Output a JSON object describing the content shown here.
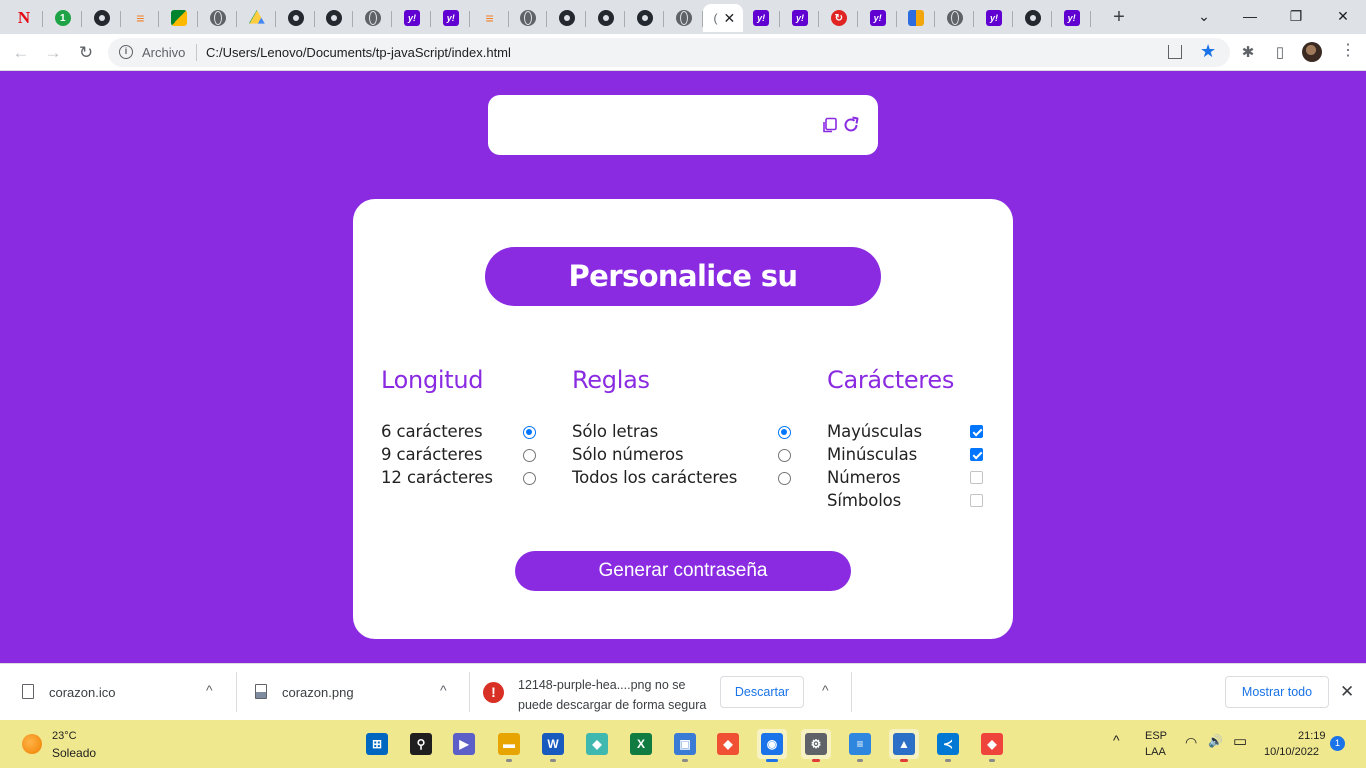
{
  "browser": {
    "tabs": [
      {
        "icon": "netflix-icon",
        "glyph": "N"
      },
      {
        "icon": "green-counter-icon",
        "glyph": "1"
      },
      {
        "icon": "github-icon",
        "glyph": ""
      },
      {
        "icon": "stackoverflow-icon",
        "glyph": "≡"
      },
      {
        "icon": "google-meet-icon",
        "glyph": ""
      },
      {
        "icon": "globe-icon",
        "glyph": ""
      },
      {
        "icon": "google-drive-icon",
        "glyph": ""
      },
      {
        "icon": "github-icon",
        "glyph": ""
      },
      {
        "icon": "github-icon",
        "glyph": ""
      },
      {
        "icon": "globe-icon",
        "glyph": ""
      },
      {
        "icon": "yahoo-icon",
        "glyph": "y!"
      },
      {
        "icon": "yahoo-icon",
        "glyph": "y!"
      },
      {
        "icon": "stackoverflow-icon",
        "glyph": "≡"
      },
      {
        "icon": "globe-icon",
        "glyph": ""
      },
      {
        "icon": "github-icon",
        "glyph": ""
      },
      {
        "icon": "github-icon",
        "glyph": ""
      },
      {
        "icon": "github-icon",
        "glyph": ""
      },
      {
        "icon": "globe-icon",
        "glyph": ""
      },
      {
        "icon": "loading-icon",
        "glyph": "(",
        "active": true
      },
      {
        "icon": "yahoo-icon",
        "glyph": "y!"
      },
      {
        "icon": "yahoo-icon",
        "glyph": "y!"
      },
      {
        "icon": "red-circle-icon",
        "glyph": "↻"
      },
      {
        "icon": "yahoo-icon",
        "glyph": "y!"
      },
      {
        "icon": "multicolor-app-icon",
        "glyph": ""
      },
      {
        "icon": "globe-icon",
        "glyph": ""
      },
      {
        "icon": "yahoo-icon",
        "glyph": "y!"
      },
      {
        "icon": "github-icon",
        "glyph": ""
      },
      {
        "icon": "yahoo-icon",
        "glyph": "y!"
      }
    ],
    "new_tab": "+",
    "window_controls": {
      "dropdown": "⌄",
      "minimize": "—",
      "restore": "❐",
      "close": "✕"
    },
    "active_tab_close": "✕",
    "back": "←",
    "forward": "→",
    "reload": "↻",
    "info": "i",
    "scheme_label": "Archivo",
    "url": "C:/Users/Lenovo/Documents/tp-javaScript/index.html",
    "star": "★",
    "extensions": "✱",
    "sidepanel": "▯",
    "menu": "⋮"
  },
  "page": {
    "password_output": "",
    "title": "Personalice su contraseña",
    "columns": {
      "longitud": {
        "heading": "Longitud",
        "options": [
          {
            "label": "6 carácteres",
            "checked": true
          },
          {
            "label": "9 carácteres",
            "checked": false
          },
          {
            "label": "12 carácteres",
            "checked": false
          }
        ]
      },
      "reglas": {
        "heading": "Reglas",
        "options": [
          {
            "label": "Sólo letras",
            "checked": true
          },
          {
            "label": "Sólo números",
            "checked": false
          },
          {
            "label": "Todos los carácteres",
            "checked": false
          }
        ]
      },
      "caracteres": {
        "heading": "Carácteres",
        "options": [
          {
            "label": "Mayúsculas",
            "checked": true
          },
          {
            "label": "Minúsculas",
            "checked": true
          },
          {
            "label": "Números",
            "checked": false,
            "disabled": true
          },
          {
            "label": "Símbolos",
            "checked": false,
            "disabled": true
          }
        ]
      }
    },
    "generate_button": "Generar contraseña",
    "colors": {
      "accent": "#8a2be2",
      "control": "#0075ff"
    }
  },
  "downloads": {
    "items": [
      {
        "name": "corazon.ico",
        "caret": "^"
      },
      {
        "name": "corazon.png",
        "caret": "^"
      }
    ],
    "error": {
      "icon": "!",
      "text": "12148-purple-hea....png no se puede descargar de forma segura",
      "discard_button": "Descartar",
      "caret": "^"
    },
    "show_all": "Mostrar todo",
    "close": "✕"
  },
  "taskbar": {
    "weather": {
      "temp": "23°C",
      "desc": "Soleado"
    },
    "apps": [
      {
        "name": "windows-start-icon",
        "glyph": "⊞",
        "color": "#0067c0"
      },
      {
        "name": "search-icon",
        "glyph": "⚲",
        "color": "#1f1f1f"
      },
      {
        "name": "teams-chat-icon",
        "glyph": "▶",
        "color": "#5b5fc7"
      },
      {
        "name": "file-explorer-icon",
        "glyph": "▬",
        "color": "#e8a400"
      },
      {
        "name": "word-icon",
        "glyph": "W",
        "color": "#185abd"
      },
      {
        "name": "gitkraken-icon",
        "glyph": "◆",
        "color": "#3fb8af"
      },
      {
        "name": "excel-icon",
        "glyph": "X",
        "color": "#107c41"
      },
      {
        "name": "remote-desktop-icon",
        "glyph": "▣",
        "color": "#3a7bd5"
      },
      {
        "name": "git-icon",
        "glyph": "◆",
        "color": "#f05033"
      },
      {
        "name": "chrome-icon",
        "glyph": "◉",
        "color": "#1a73e8"
      },
      {
        "name": "settings-icon",
        "glyph": "⚙",
        "color": "#5f6368"
      },
      {
        "name": "notepad-icon",
        "glyph": "≡",
        "color": "#2e86de"
      },
      {
        "name": "photos-icon",
        "glyph": "▲",
        "color": "#2b6fc7"
      },
      {
        "name": "vscode-icon",
        "glyph": "≺",
        "color": "#0078d4"
      },
      {
        "name": "anydesk-icon",
        "glyph": "◆",
        "color": "#ef443b"
      }
    ],
    "tray": {
      "chevron": "^",
      "lang_top": "ESP",
      "lang_bottom": "LAA",
      "wifi": "◠",
      "volume": "🔊",
      "battery": "▭",
      "time": "21:19",
      "date": "10/10/2022",
      "notifications": "1"
    }
  }
}
